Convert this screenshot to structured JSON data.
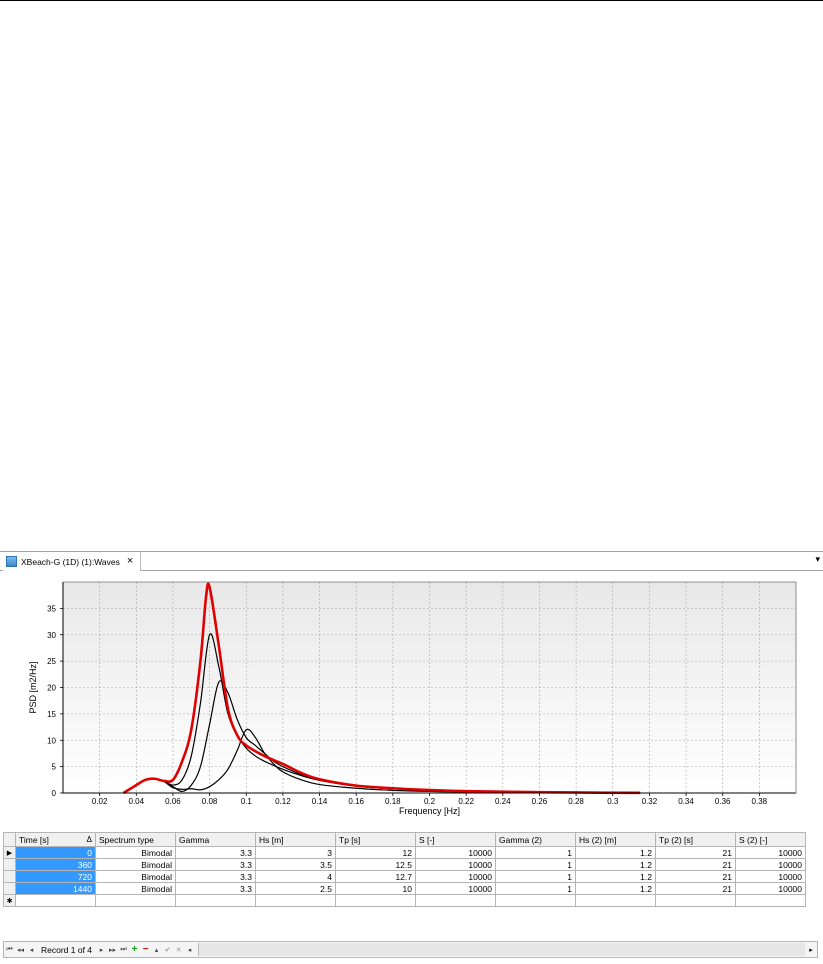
{
  "tab": {
    "label": "XBeach-G (1D) (1):Waves",
    "close": "×",
    "menu": "▾"
  },
  "chart_data": {
    "type": "line",
    "xlabel": "Frequency [Hz]",
    "ylabel": "PSD [m2/Hz]",
    "xlim": [
      0,
      0.4
    ],
    "ylim": [
      0,
      40
    ],
    "xticks": [
      0.02,
      0.04,
      0.06,
      0.08,
      0.1,
      0.12,
      0.14,
      0.16,
      0.18,
      0.2,
      0.22,
      0.24,
      0.26,
      0.28,
      0.3,
      0.32,
      0.34,
      0.36,
      0.38
    ],
    "xtick_labels": [
      "0.02",
      "0.04",
      "0.06",
      "0.08",
      "0.1",
      "0.12",
      "0.14",
      "0.16",
      "0.18",
      "0.2",
      "0.22",
      "0.24",
      "0.26",
      "0.28",
      "0.3",
      "0.32",
      "0.34",
      "0.36",
      "0.38"
    ],
    "yticks": [
      0,
      5,
      10,
      15,
      20,
      25,
      30,
      35
    ],
    "ytick_labels": [
      "0",
      "5",
      "10",
      "15",
      "20",
      "25",
      "30",
      "35"
    ],
    "grid": true,
    "series": [
      {
        "color": "#000000",
        "width": 1.2,
        "x": [
          0.033,
          0.04,
          0.045,
          0.05,
          0.055,
          0.06,
          0.065,
          0.07,
          0.075,
          0.08,
          0.085,
          0.09,
          0.095,
          0.1,
          0.105,
          0.11,
          0.115,
          0.12,
          0.13,
          0.14,
          0.16,
          0.18,
          0.2,
          0.22,
          0.25,
          0.28
        ],
        "y": [
          0,
          1.5,
          2.5,
          2.7,
          2.3,
          1.2,
          0.3,
          1.5,
          5,
          13,
          21,
          19,
          14,
          10.5,
          9,
          7.5,
          6,
          5,
          3.5,
          2.4,
          1.3,
          0.8,
          0.5,
          0.3,
          0.15,
          0.05
        ]
      },
      {
        "color": "#000000",
        "width": 1.2,
        "x": [
          0.033,
          0.04,
          0.045,
          0.05,
          0.055,
          0.06,
          0.065,
          0.07,
          0.075,
          0.08,
          0.085,
          0.09,
          0.095,
          0.1,
          0.105,
          0.11,
          0.12,
          0.13,
          0.14,
          0.16,
          0.18,
          0.2,
          0.22,
          0.25,
          0.28
        ],
        "y": [
          0,
          1.5,
          2.5,
          2.7,
          2.3,
          1.5,
          2.5,
          7,
          17,
          30,
          24,
          15,
          11,
          8.5,
          7,
          6,
          4.5,
          3.3,
          2.4,
          1.3,
          0.8,
          0.5,
          0.3,
          0.15,
          0.05
        ]
      },
      {
        "color": "#000000",
        "width": 1.2,
        "x": [
          0.033,
          0.04,
          0.045,
          0.05,
          0.055,
          0.06,
          0.065,
          0.07,
          0.075,
          0.08,
          0.085,
          0.09,
          0.095,
          0.1,
          0.105,
          0.11,
          0.115,
          0.12,
          0.13,
          0.14,
          0.16,
          0.18,
          0.2,
          0.22,
          0.25,
          0.28
        ],
        "y": [
          0,
          1.5,
          2.5,
          2.7,
          2.2,
          1.0,
          0.7,
          0.8,
          0.6,
          1.2,
          2.5,
          4.5,
          8,
          12,
          10.5,
          7.5,
          5.5,
          4,
          2.5,
          1.6,
          0.9,
          0.5,
          0.3,
          0.2,
          0.1,
          0.05
        ]
      },
      {
        "color": "#e00000",
        "width": 2.6,
        "x": [
          0.033,
          0.04,
          0.045,
          0.05,
          0.055,
          0.06,
          0.065,
          0.07,
          0.075,
          0.078,
          0.08,
          0.085,
          0.09,
          0.095,
          0.1,
          0.11,
          0.12,
          0.13,
          0.14,
          0.16,
          0.18,
          0.2,
          0.22,
          0.25,
          0.28,
          0.315
        ],
        "y": [
          0,
          1.5,
          2.5,
          2.7,
          2.3,
          2.5,
          6,
          12,
          25,
          37,
          39,
          28,
          16,
          11,
          9,
          7,
          5.5,
          3.8,
          2.6,
          1.4,
          0.9,
          0.55,
          0.35,
          0.2,
          0.1,
          0.03
        ]
      }
    ]
  },
  "table": {
    "columns": [
      {
        "label": "Time [s]",
        "width": 80
      },
      {
        "label": "Spectrum type",
        "width": 80
      },
      {
        "label": "Gamma",
        "width": 80
      },
      {
        "label": "Hs [m]",
        "width": 80
      },
      {
        "label": "Tp [s]",
        "width": 80
      },
      {
        "label": "S [-]",
        "width": 80
      },
      {
        "label": "Gamma (2)",
        "width": 80
      },
      {
        "label": "Hs (2) [m]",
        "width": 80
      },
      {
        "label": "Tp (2) [s]",
        "width": 80
      },
      {
        "label": "S (2) [-]",
        "width": 70
      }
    ],
    "sort_indicator": "Δ",
    "rows": [
      [
        "0",
        "Bimodal",
        "3.3",
        "3",
        "12",
        "10000",
        "1",
        "1.2",
        "21",
        "10000"
      ],
      [
        "360",
        "Bimodal",
        "3.3",
        "3.5",
        "12.5",
        "10000",
        "1",
        "1.2",
        "21",
        "10000"
      ],
      [
        "720",
        "Bimodal",
        "3.3",
        "4",
        "12.7",
        "10000",
        "1",
        "1.2",
        "21",
        "10000"
      ],
      [
        "1440",
        "Bimodal",
        "3.3",
        "2.5",
        "10",
        "10000",
        "1",
        "1.2",
        "21",
        "10000"
      ]
    ],
    "current_row_marker": "▶",
    "new_row_marker": "✱"
  },
  "navigator": {
    "record_text": "Record 1 of 4",
    "first": "⏮",
    "prev_page": "◂◂",
    "prev": "◂",
    "next": "▸",
    "next_page": "▸▸",
    "last": "⏭",
    "append": "+",
    "remove": "−",
    "edit": "▴",
    "end_edit": "✔",
    "cancel_edit": "✕",
    "scroll_left": "◂",
    "scroll_right": "▸"
  }
}
